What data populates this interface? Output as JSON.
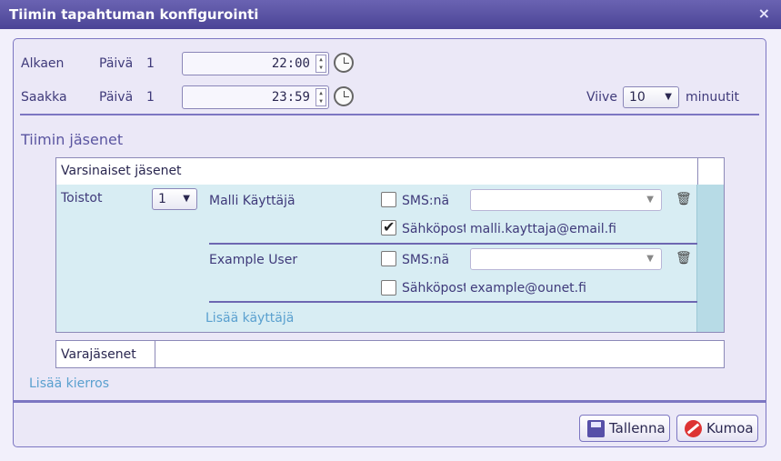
{
  "window": {
    "title": "Tiimin tapahtuman konfigurointi",
    "close_glyph": "×"
  },
  "schedule": {
    "from": {
      "label": "Alkaen",
      "day_label": "Päivä",
      "day": "1",
      "time": "22:00"
    },
    "until": {
      "label": "Saakka",
      "day_label": "Päivä",
      "day": "1",
      "time": "23:59"
    },
    "delay": {
      "label": "Viive",
      "value": "10",
      "unit": "minuutit"
    }
  },
  "team": {
    "title": "Tiimin jäsenet",
    "regular_header": "Varsinaiset jäsenet",
    "repeat_label": "Toistot",
    "repeat_value": "1",
    "members": [
      {
        "name": "Malli Käyttäjä",
        "sms_label": "SMS:nä",
        "sms_checked": false,
        "email_label": "Sähköpost",
        "email_checked": true,
        "email": "malli.kayttaja@email.fi"
      },
      {
        "name": "Example User",
        "sms_label": "SMS:nä",
        "sms_checked": false,
        "email_label": "Sähköpost",
        "email_checked": false,
        "email": "example@ounet.fi"
      }
    ],
    "add_user": "Lisää käyttäjä",
    "reserve_header": "Varajäsenet",
    "add_round": "Lisää kierros"
  },
  "footer": {
    "save_label": "Tallenna",
    "cancel_label": "Kumoa"
  },
  "glyphs": {
    "dropdown_arrow": "▼",
    "spin_up": "▲",
    "spin_down": "▼",
    "trash": "🗑"
  },
  "colors": {
    "titlebar": "#5750a8",
    "accent": "#7c76c2",
    "member_bg": "#d8edf3",
    "link": "#5aa0cf"
  }
}
